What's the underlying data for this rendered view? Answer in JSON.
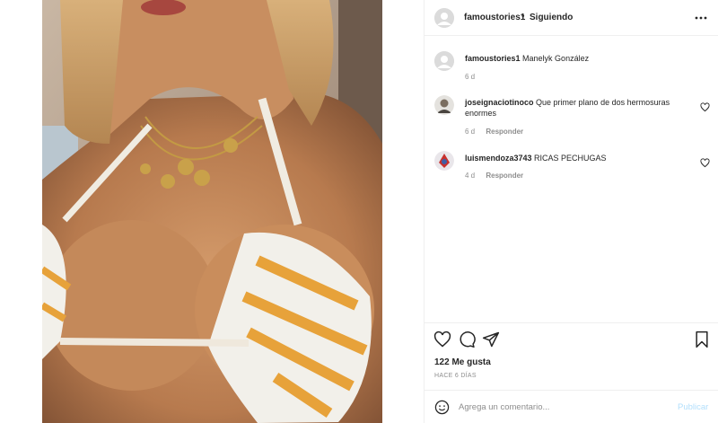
{
  "post": {
    "author": "famoustories1",
    "separator": "•",
    "follow_status": "Siguiendo",
    "caption": {
      "user": "famoustories1",
      "text": "Manelyk González",
      "time": "6 d"
    }
  },
  "comments": [
    {
      "user": "joseignaciotinoco",
      "text": "Que primer plano de dos hermosuras enormes",
      "time": "6 d",
      "reply_label": "Responder"
    },
    {
      "user": "luismendoza3743",
      "text": "RICAS PECHUGAS",
      "time": "4 d",
      "reply_label": "Responder"
    }
  ],
  "likes": {
    "count_text": "122 Me gusta",
    "posted_ago": "HACE 6 DÍAS"
  },
  "composer": {
    "placeholder": "Agrega un comentario...",
    "publish_label": "Publicar"
  },
  "icons": {
    "header_more": "more-horizontal-icon",
    "like": "heart-icon",
    "comment": "comment-bubble-icon",
    "share": "paper-plane-icon",
    "save": "bookmark-icon",
    "emoji": "smiley-icon"
  },
  "colors": {
    "text_primary": "#262626",
    "text_secondary": "#8e8e8e",
    "divider": "#efefef",
    "publish_disabled": "#b2dffc"
  }
}
